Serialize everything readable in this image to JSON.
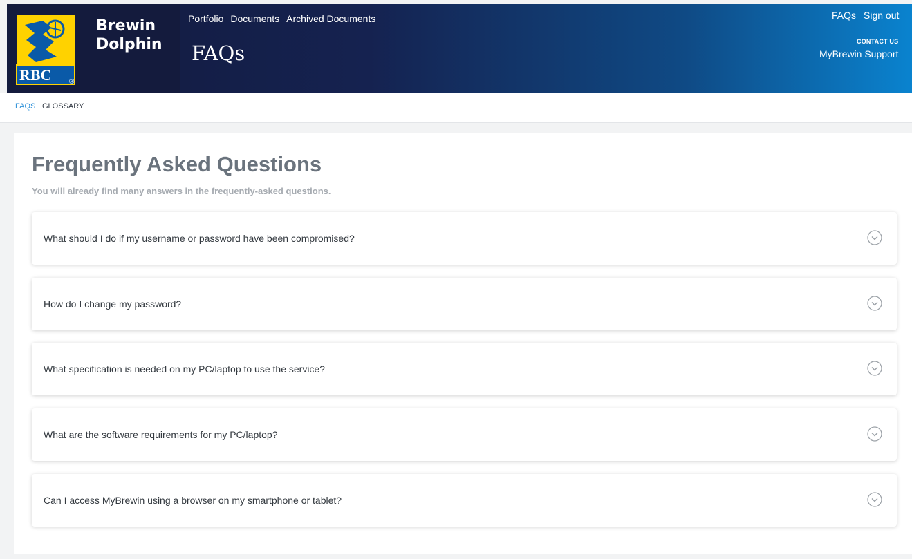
{
  "brand": {
    "line1": "Brewin",
    "line2": "Dolphin",
    "logo_text": "RBC",
    "logo_mark": "®"
  },
  "nav": {
    "items": [
      "Portfolio",
      "Documents",
      "Archived Documents"
    ]
  },
  "page": {
    "title": "FAQs"
  },
  "top_right": {
    "faqs_link": "FAQs",
    "signout_link": "Sign out",
    "contact_label": "CONTACT US",
    "support_link": "MyBrewin Support"
  },
  "subnav": {
    "active": "FAQS",
    "other": "GLOSSARY"
  },
  "faq": {
    "heading": "Frequently Asked Questions",
    "subheading": "You will already find many answers in the frequently-asked questions.",
    "items": [
      {
        "question": "What should I do if my username or password have been compromised?"
      },
      {
        "question": "How do I change my password?"
      },
      {
        "question": "What specification is needed on my PC/laptop to use the service?"
      },
      {
        "question": "What are the software requirements for my PC/laptop?"
      },
      {
        "question": "Can I access MyBrewin using a browser on my smartphone or tablet?"
      }
    ]
  },
  "colors": {
    "header_dark": "#141b3d",
    "header_light": "#0a83cf",
    "shield_blue": "#0a5aa8",
    "shield_yellow": "#ffd200",
    "active_link": "#2a8fd8",
    "heading_gray": "#6a737d"
  },
  "icons": {
    "expand": "chevron-down-circle-icon",
    "logo": "rbc-shield-icon"
  }
}
